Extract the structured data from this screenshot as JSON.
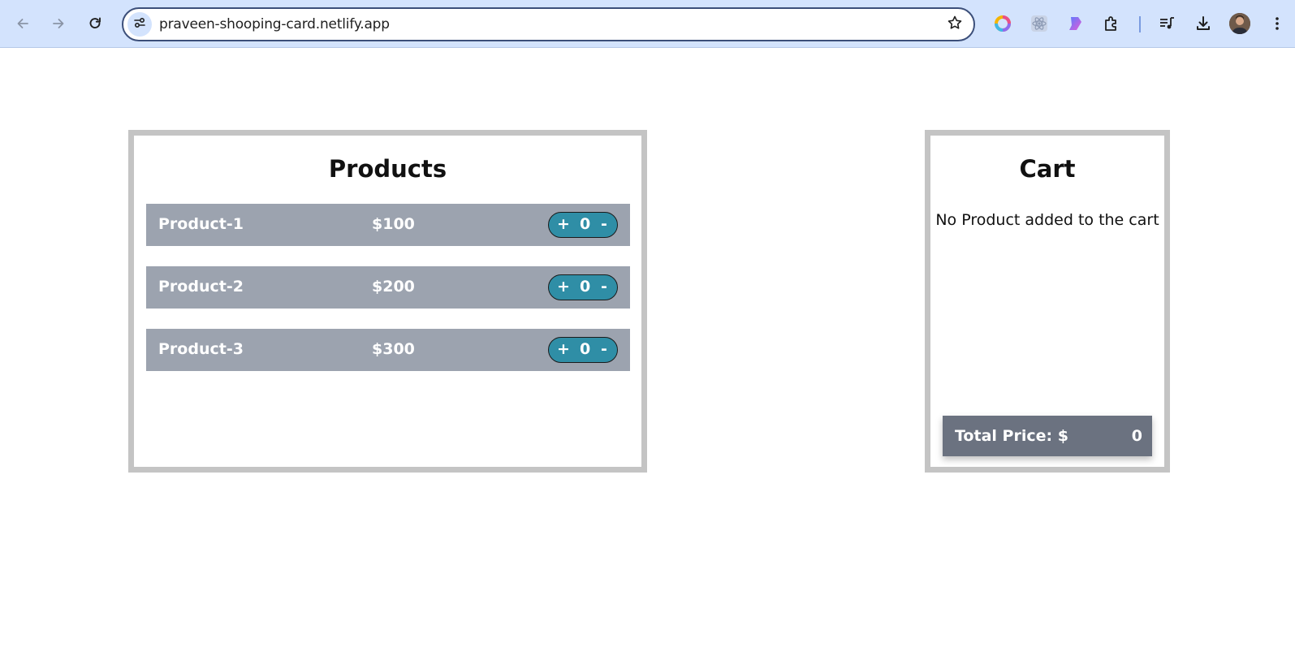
{
  "browser": {
    "url": "praveen-shooping-card.netlify.app",
    "icons": {
      "back": "arrow-left-icon",
      "forward": "arrow-right-icon",
      "reload": "reload-icon",
      "site_info": "tune-icon",
      "bookmark": "star-icon",
      "extensions": [
        "color-wheel-icon",
        "react-icon",
        "gradient-shape-icon",
        "puzzle-icon"
      ],
      "media": "queue-music-icon",
      "downloads": "download-icon",
      "menu": "kebab-menu-icon"
    },
    "colors": {
      "toolbar_bg": "#d3e3fd",
      "omnibox_border": "#3c4f7a"
    }
  },
  "products": {
    "title": "Products",
    "items": [
      {
        "name": "Product-1",
        "price": "$100",
        "plus": "+",
        "qty": "0",
        "minus": "-"
      },
      {
        "name": "Product-2",
        "price": "$200",
        "plus": "+",
        "qty": "0",
        "minus": "-"
      },
      {
        "name": "Product-3",
        "price": "$300",
        "plus": "+",
        "qty": "0",
        "minus": "-"
      }
    ],
    "colors": {
      "row_bg": "#9ca3af",
      "qty_pill_bg": "#2f8ea6",
      "panel_border": "#c4c4c4"
    }
  },
  "cart": {
    "title": "Cart",
    "empty_message": "No Product added to the cart",
    "total_label": "Total Price: $",
    "total_value": "0",
    "colors": {
      "total_bar_bg": "#6b7280"
    }
  }
}
